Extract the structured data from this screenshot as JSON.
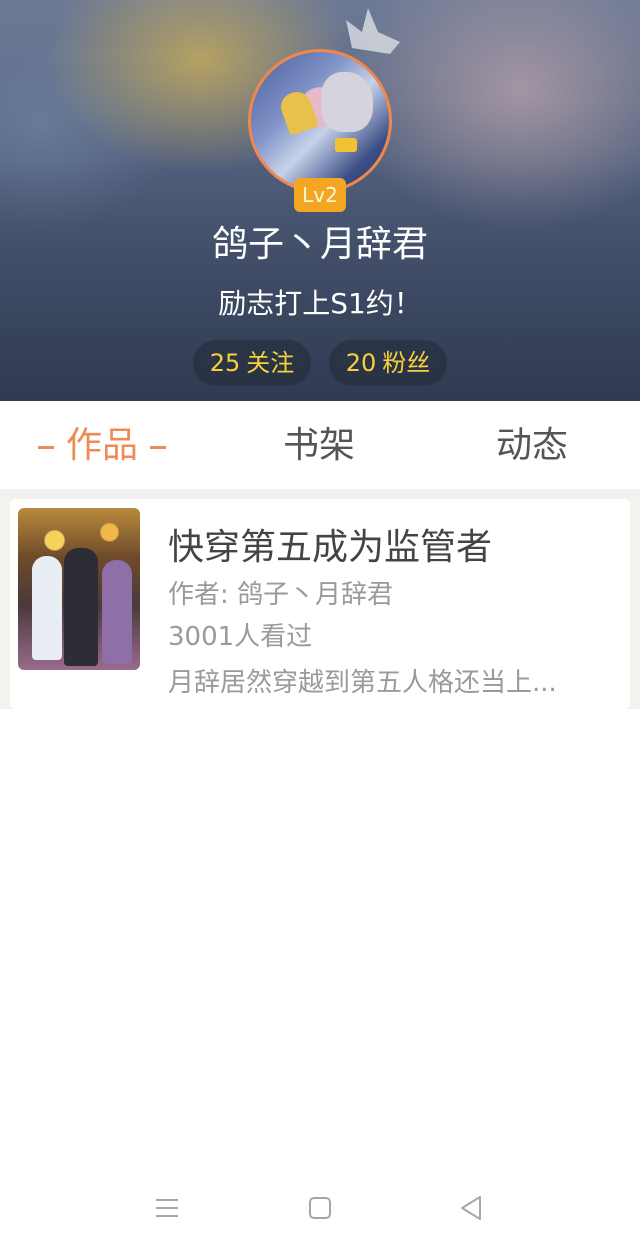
{
  "profile": {
    "level": "Lv2",
    "username": "鸽子丶月辞君",
    "bio": "励志打上S1约！",
    "stats": {
      "following_count": "25",
      "following_label": "关注",
      "fans_count": "20",
      "fans_label": "粉丝"
    }
  },
  "tabs": [
    {
      "label": "作品",
      "active": true
    },
    {
      "label": "书架",
      "active": false
    },
    {
      "label": "动态",
      "active": false
    }
  ],
  "works": [
    {
      "title": "快穿第五成为监管者",
      "author": "作者: 鸽子丶月辞君",
      "views": "3001人看过",
      "description": "月辞居然穿越到第五人格还当上..."
    }
  ],
  "system_nav": {
    "icons": [
      "menu-icon",
      "home-icon",
      "back-icon"
    ]
  },
  "colors": {
    "accent": "#ee8a55",
    "badge": "#f4a623",
    "stat_text": "#f5d23a",
    "avatar_border": "#f0874d"
  }
}
